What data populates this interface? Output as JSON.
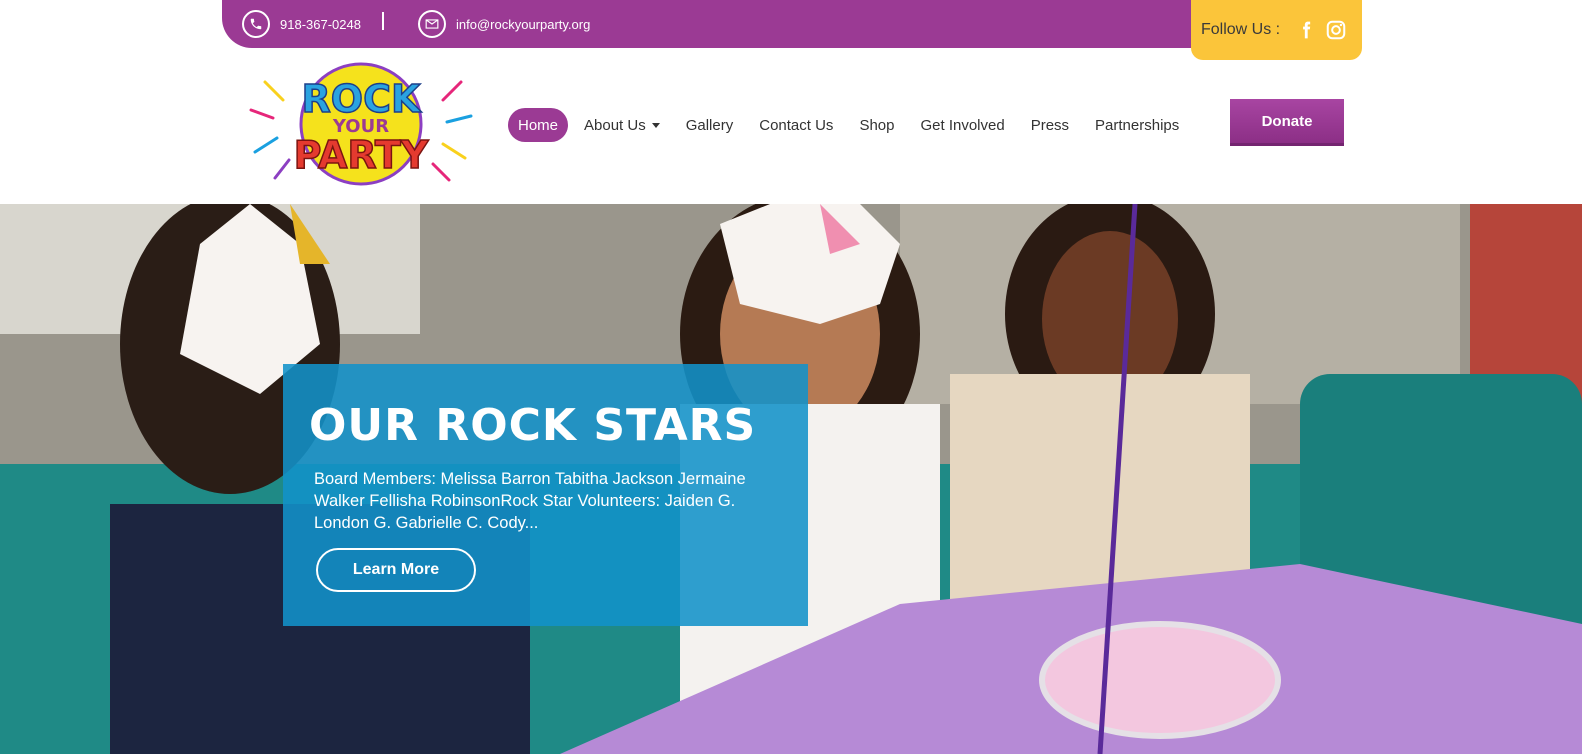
{
  "topbar": {
    "phone": "918-367-0248",
    "email": "info@rockyourparty.org",
    "follow_label": "Follow Us :",
    "social_icons": [
      "facebook-icon",
      "instagram-icon"
    ]
  },
  "logo": {
    "line1": "ROCK",
    "line2": "YOUR",
    "line3": "PARTY"
  },
  "nav": {
    "items": [
      {
        "label": "Home",
        "active": true
      },
      {
        "label": "About Us",
        "dropdown": true
      },
      {
        "label": "Gallery"
      },
      {
        "label": "Contact Us"
      },
      {
        "label": "Shop"
      },
      {
        "label": "Get Involved"
      },
      {
        "label": "Press"
      },
      {
        "label": "Partnerships"
      }
    ],
    "donate_label": "Donate"
  },
  "hero": {
    "title": "OUR ROCK STARS",
    "text": "Board Members: Melissa Barron Tabitha Jackson Jermaine Walker Fellisha RobinsonRock Star Volunteers: Jaiden G. London G. Gabrielle C. Cody...",
    "button_label": "Learn More"
  },
  "colors": {
    "brand_purple": "#9b3a94",
    "accent_yellow": "#fbc53a",
    "card_blue": "#1292ca"
  }
}
